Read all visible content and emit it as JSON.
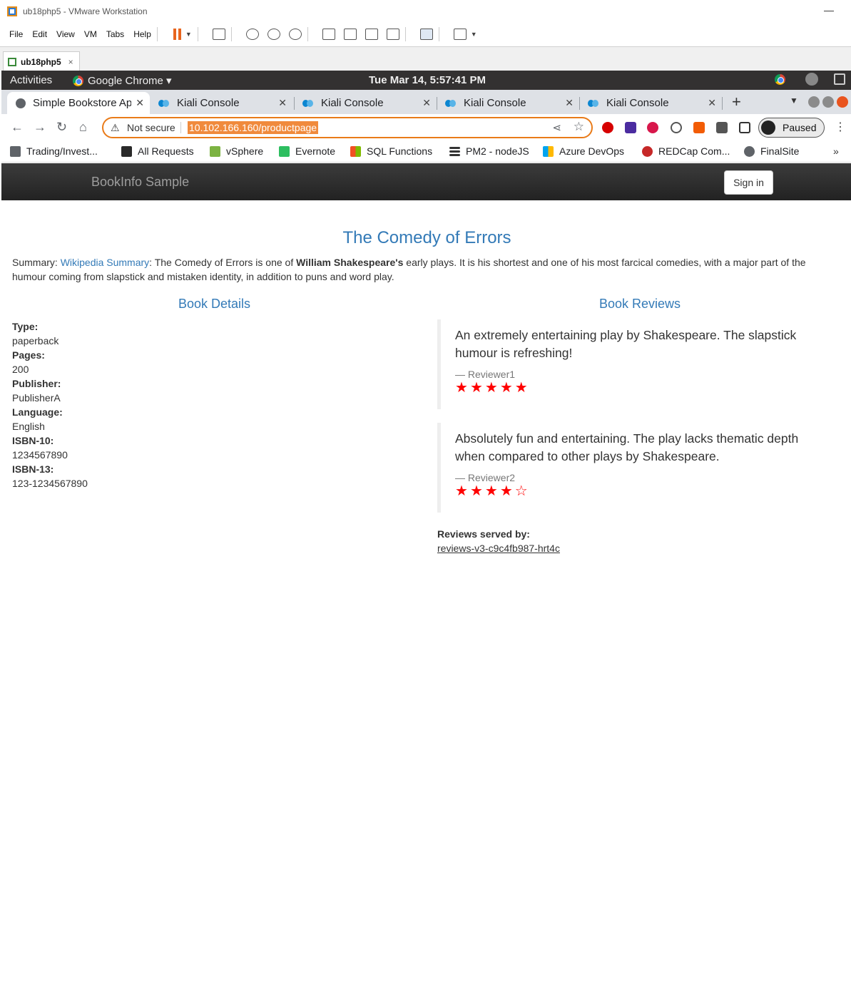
{
  "vmware": {
    "title": "ub18php5 - VMware Workstation",
    "menu": [
      "File",
      "Edit",
      "View",
      "VM",
      "Tabs",
      "Help"
    ],
    "tab_label": "ub18php5",
    "tab_close": "×"
  },
  "gnome": {
    "activities": "Activities",
    "app_name": "Google Chrome ▾",
    "clock": "Tue Mar 14,  5:57:41 PM"
  },
  "chrome": {
    "tabs": [
      {
        "title": "Simple Bookstore Ap",
        "active": true
      },
      {
        "title": "Kiali Console",
        "active": false
      },
      {
        "title": "Kiali Console",
        "active": false
      },
      {
        "title": "Kiali Console",
        "active": false
      },
      {
        "title": "Kiali Console",
        "active": false
      }
    ],
    "security_label": "Not secure",
    "url": "10.102.166.160/productpage",
    "profile_label": "Paused",
    "bookmarks": [
      {
        "label": "Trading/Invest...",
        "icon": "folder-icon",
        "color": "#5f6368"
      },
      {
        "label": "All Requests",
        "icon": "requests-icon",
        "color": "#2a2a2a"
      },
      {
        "label": "vSphere",
        "icon": "vsphere-icon",
        "color": "#7cb342"
      },
      {
        "label": "Evernote",
        "icon": "evernote-icon",
        "color": "#2dbe60"
      },
      {
        "label": "SQL Functions",
        "icon": "microsoft-icon",
        "color": "#f25022"
      },
      {
        "label": "PM2 - nodeJS",
        "icon": "list-icon",
        "color": "#333333"
      },
      {
        "label": "Azure DevOps",
        "icon": "microsoft-icon",
        "color": "#00a4ef"
      },
      {
        "label": "REDCap Com...",
        "icon": "redcap-icon",
        "color": "#c62828"
      },
      {
        "label": "FinalSite",
        "icon": "globe-icon",
        "color": "#5f6368"
      }
    ],
    "bookmarks_more": "»"
  },
  "page": {
    "brand": "BookInfo Sample",
    "sign_in": "Sign in",
    "title": "The Comedy of Errors",
    "summary_prefix": "Summary: ",
    "summary_link": "Wikipedia Summary",
    "summary_mid": ": The Comedy of Errors is one of ",
    "summary_bold": "William Shakespeare's",
    "summary_rest": " early plays. It is his shortest and one of his most farcical comedies, with a major part of the humour coming from slapstick and mistaken identity, in addition to puns and word play.",
    "details_heading": "Book Details",
    "reviews_heading": "Book Reviews",
    "details": [
      {
        "key": "Type:",
        "value": "paperback"
      },
      {
        "key": "Pages:",
        "value": "200"
      },
      {
        "key": "Publisher:",
        "value": "PublisherA"
      },
      {
        "key": "Language:",
        "value": "English"
      },
      {
        "key": "ISBN-10:",
        "value": "1234567890"
      },
      {
        "key": "ISBN-13:",
        "value": "123-1234567890"
      }
    ],
    "reviews": [
      {
        "text": "An extremely entertaining play by Shakespeare. The slapstick humour is refreshing!",
        "reviewer": "— Reviewer1",
        "rating": 5,
        "max": 5,
        "star_color": "#ff0000"
      },
      {
        "text": "Absolutely fun and entertaining. The play lacks thematic depth when compared to other plays by Shakespeare.",
        "reviewer": "— Reviewer2",
        "rating": 4,
        "max": 5,
        "star_color": "#ff0000"
      }
    ],
    "served_label": "Reviews served by:",
    "served_pod": "reviews-v3-c9c4fb987-hrt4c"
  }
}
